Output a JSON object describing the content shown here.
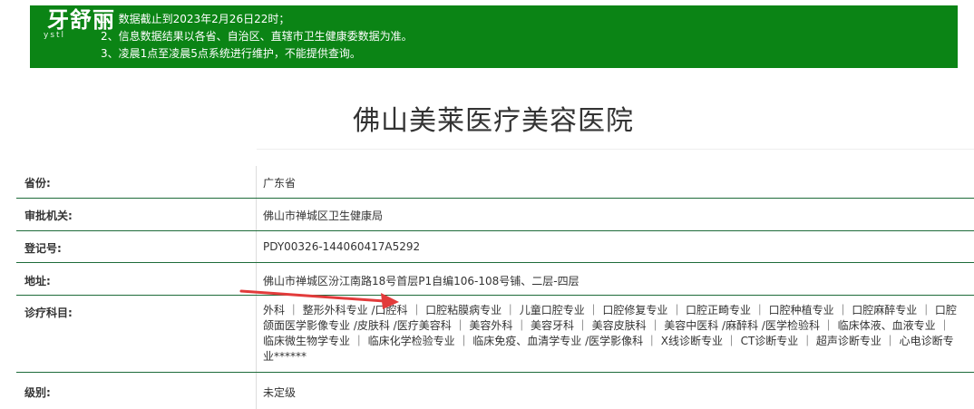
{
  "notice": {
    "lines": [
      "1、数据截止到2023年2月26日22时；",
      "2、信息数据结果以各省、自治区、直辖市卫生健康委数据为准。",
      "3、凌晨1点至凌晨5点系统进行维护，不能提供查询。"
    ],
    "bg_color": "#0b8415"
  },
  "watermark": {
    "text": "牙舒丽",
    "sub": "ystl"
  },
  "hospital": {
    "name": "佛山美莱医疗美容医院"
  },
  "info": {
    "province_label": "省份:",
    "province": "广东省",
    "authority_label": "审批机关:",
    "authority": "佛山市禅城区卫生健康局",
    "reg_label": "登记号:",
    "reg": "PDY00326-144060417A5292",
    "address_label": "地址:",
    "address": "佛山市禅城区汾江南路18号首层P1自编106-108号铺、二层-四层",
    "departments_label": "诊疗科目:",
    "departments": "外科 ｜ 整形外科专业 /口腔科 ｜ 口腔粘膜病专业 ｜ 儿童口腔专业 ｜ 口腔修复专业 ｜ 口腔正畸专业 ｜ 口腔种植专业 ｜ 口腔麻醉专业 ｜ 口腔颌面医学影像专业 /皮肤科 /医疗美容科 ｜ 美容外科 ｜ 美容牙科 ｜ 美容皮肤科 ｜ 美容中医科 /麻醉科 /医学检验科 ｜ 临床体液、血液专业 ｜ 临床微生物学专业 ｜ 临床化学检验专业 ｜ 临床免疫、血清学专业 /医学影像科 ｜ X线诊断专业 ｜ CT诊断专业 ｜ 超声诊断专业 ｜ 心电诊断专业******",
    "level_label": "级别:",
    "level": "未定级"
  },
  "colors": {
    "row_border": "#1e6b3a",
    "arrow": "#e23b3b"
  }
}
